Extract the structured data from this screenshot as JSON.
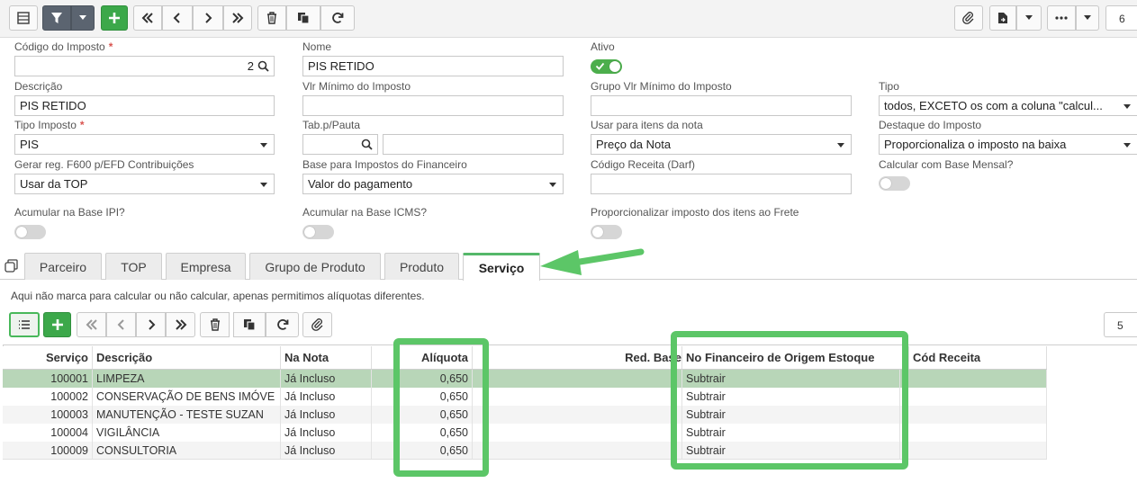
{
  "toolbar": {
    "page_value": "6",
    "icons": [
      "grid-view-icon",
      "filter-icon",
      "caret-down-icon",
      "add-icon",
      "first-icon",
      "prev-icon",
      "next-icon",
      "last-icon",
      "delete-icon",
      "copy-icon",
      "refresh-icon",
      "attach-icon",
      "document-icon",
      "more-icon"
    ]
  },
  "form": {
    "codigo_label": "Código do Imposto",
    "codigo_value": "2",
    "nome_label": "Nome",
    "nome_value": "PIS RETIDO",
    "ativo_label": "Ativo",
    "ativo_on": true,
    "descricao_label": "Descrição",
    "descricao_value": "PIS RETIDO",
    "vlr_minimo_label": "Vlr Mínimo do Imposto",
    "vlr_minimo_value": "",
    "grupo_vlr_label": "Grupo Vlr Mínimo do Imposto",
    "grupo_vlr_value": "",
    "tipo_label": "Tipo",
    "tipo_value": "todos, EXCETO os com a coluna \"calcul...",
    "tipo_imposto_label": "Tipo Imposto",
    "tipo_imposto_value": "PIS",
    "tab_pauta_label": "Tab.p/Pauta",
    "usar_itens_label": "Usar para itens da nota",
    "usar_itens_value": "Preço da Nota",
    "destaque_label": "Destaque do Imposto",
    "destaque_value": "Proporcionaliza o imposto na baixa",
    "gerar_f600_label": "Gerar reg. F600 p/EFD Contribuições",
    "gerar_f600_value": "Usar da TOP",
    "base_fin_label": "Base para Impostos do Financeiro",
    "base_fin_value": "Valor do pagamento",
    "cod_receita_label": "Código Receita (Darf)",
    "cod_receita_value": "",
    "calc_base_mensal_label": "Calcular com Base Mensal?",
    "acum_ipi_label": "Acumular na Base IPI?",
    "acum_icms_label": "Acumular na Base ICMS?",
    "proporcionalizar_label": "Proporcionalizar imposto dos itens ao Frete"
  },
  "tabs": [
    "Parceiro",
    "TOP",
    "Empresa",
    "Grupo de Produto",
    "Produto",
    "Serviço"
  ],
  "active_tab": "Serviço",
  "note": "Aqui não marca para calcular ou não calcular, apenas permitimos alíquotas diferentes.",
  "grid_toolbar": {
    "page_value": "5"
  },
  "grid": {
    "headers": [
      "Serviço",
      "Descrição",
      "Na Nota",
      "Alíquota",
      "Red. Base",
      "No Financeiro de Origem Estoque",
      "Cód Receita"
    ],
    "rows": [
      {
        "servico": "100001",
        "descricao": "LIMPEZA",
        "na_nota": "Já Incluso",
        "aliquota": "0,650",
        "red_base": "",
        "financeiro": "Subtrair",
        "cod_receita": ""
      },
      {
        "servico": "100002",
        "descricao": "CONSERVAÇÃO DE BENS IMÓVE",
        "na_nota": "Já Incluso",
        "aliquota": "0,650",
        "red_base": "",
        "financeiro": "Subtrair",
        "cod_receita": ""
      },
      {
        "servico": "100003",
        "descricao": "MANUTENÇÃO - TESTE SUZAN",
        "na_nota": "Já Incluso",
        "aliquota": "0,650",
        "red_base": "",
        "financeiro": "Subtrair",
        "cod_receita": ""
      },
      {
        "servico": "100004",
        "descricao": "VIGILÂNCIA",
        "na_nota": "Já Incluso",
        "aliquota": "0,650",
        "red_base": "",
        "financeiro": "Subtrair",
        "cod_receita": ""
      },
      {
        "servico": "100009",
        "descricao": "CONSULTORIA",
        "na_nota": "Já Incluso",
        "aliquota": "0,650",
        "red_base": "",
        "financeiro": "Subtrair",
        "cod_receita": ""
      }
    ]
  },
  "colors": {
    "accent_green": "#3ca84a",
    "highlight_green": "#5cc667",
    "selected_row": "#b8d6b8",
    "required": "#d9534f"
  }
}
